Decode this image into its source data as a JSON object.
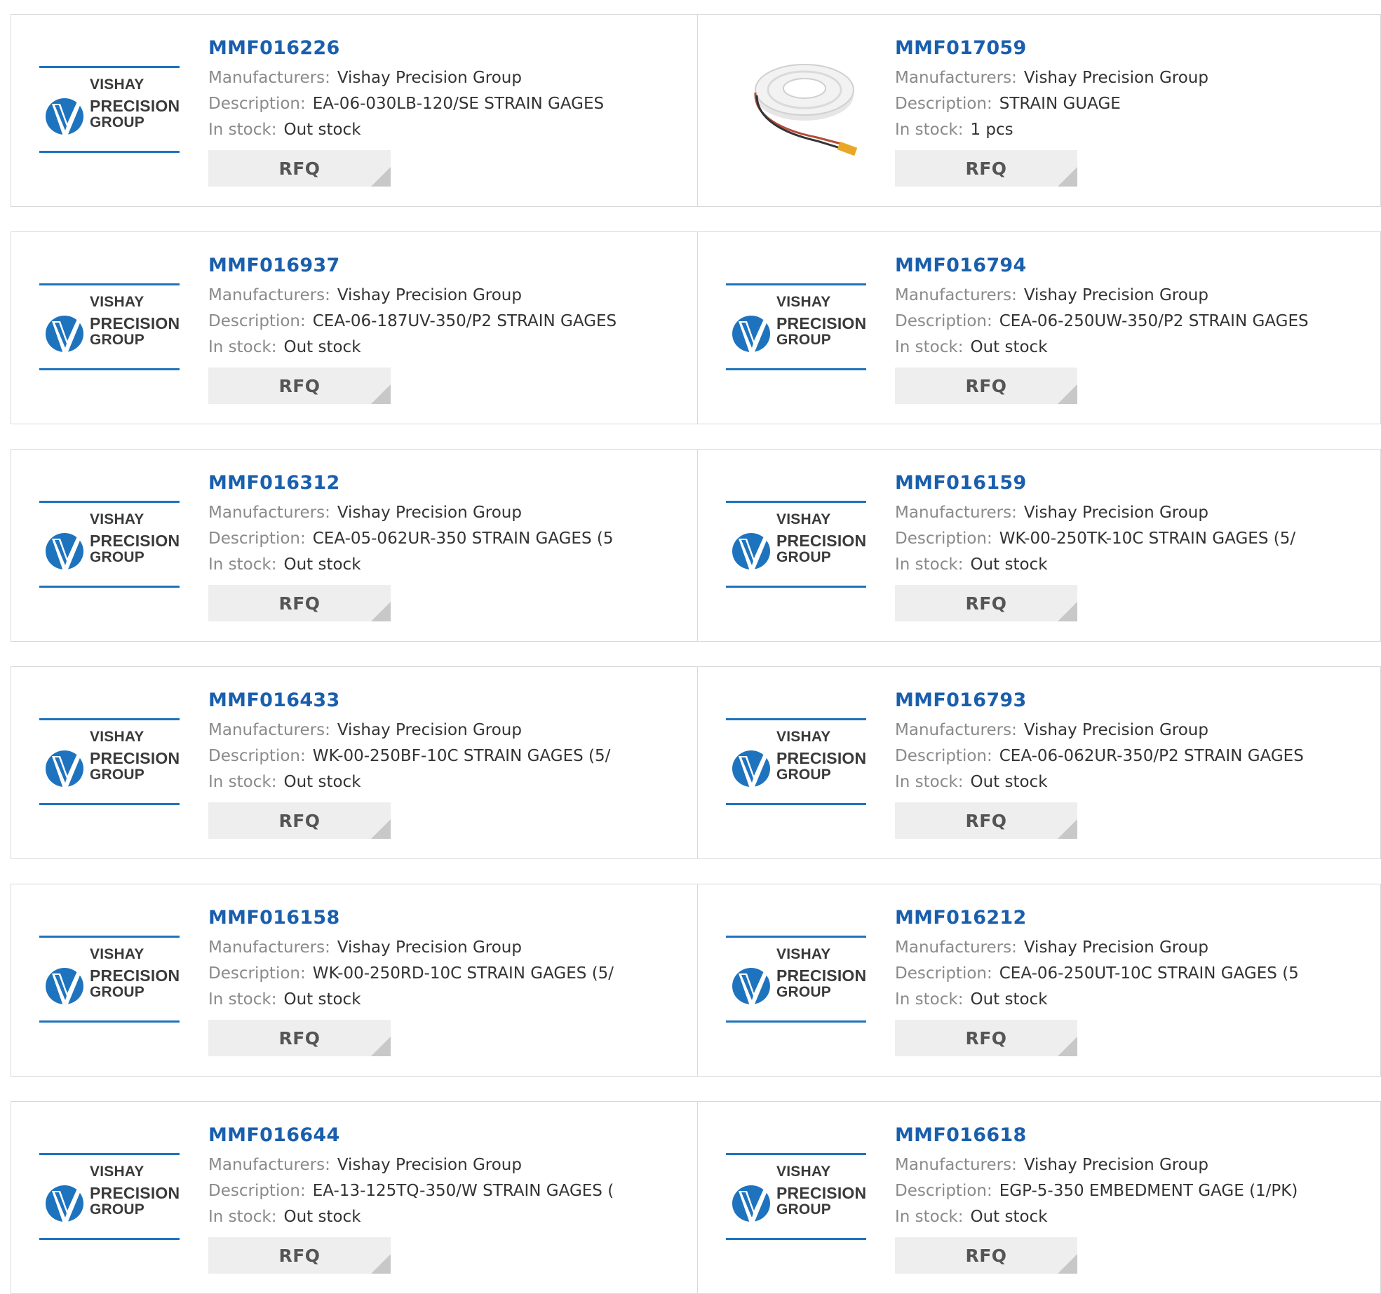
{
  "labels": {
    "manufacturers": "Manufacturers:",
    "description": "Description:",
    "in_stock": "In stock:",
    "rfq": "RFQ"
  },
  "logo": {
    "line1": "VISHAY",
    "line2": "PRECISION",
    "line3": "GROUP",
    "accent_color": "#1e73be"
  },
  "colors": {
    "part_number": "#1a5fad",
    "label": "#8a8a8a",
    "value": "#333333",
    "button_bg": "#eeeeee",
    "border": "#d9d9d9"
  },
  "products": [
    {
      "part": "MMF016226",
      "manufacturer": "Vishay Precision Group",
      "description": "EA-06-030LB-120/SE STRAIN GAGES",
      "stock": "Out stock",
      "image": "vishay-logo"
    },
    {
      "part": "MMF017059",
      "manufacturer": "Vishay Precision Group",
      "description": "STRAIN GUAGE",
      "stock": "1 pcs",
      "image": "strain-gauge-spool-photo"
    },
    {
      "part": "MMF016937",
      "manufacturer": "Vishay Precision Group",
      "description": "CEA-06-187UV-350/P2 STRAIN GAGES",
      "stock": "Out stock",
      "image": "vishay-logo"
    },
    {
      "part": "MMF016794",
      "manufacturer": "Vishay Precision Group",
      "description": "CEA-06-250UW-350/P2 STRAIN GAGES",
      "stock": "Out stock",
      "image": "vishay-logo"
    },
    {
      "part": "MMF016312",
      "manufacturer": "Vishay Precision Group",
      "description": "CEA-05-062UR-350 STRAIN GAGES (5",
      "stock": "Out stock",
      "image": "vishay-logo"
    },
    {
      "part": "MMF016159",
      "manufacturer": "Vishay Precision Group",
      "description": "WK-00-250TK-10C STRAIN GAGES (5/",
      "stock": "Out stock",
      "image": "vishay-logo"
    },
    {
      "part": "MMF016433",
      "manufacturer": "Vishay Precision Group",
      "description": "WK-00-250BF-10C STRAIN GAGES (5/",
      "stock": "Out stock",
      "image": "vishay-logo"
    },
    {
      "part": "MMF016793",
      "manufacturer": "Vishay Precision Group",
      "description": "CEA-06-062UR-350/P2 STRAIN GAGES",
      "stock": "Out stock",
      "image": "vishay-logo"
    },
    {
      "part": "MMF016158",
      "manufacturer": "Vishay Precision Group",
      "description": "WK-00-250RD-10C STRAIN GAGES (5/",
      "stock": "Out stock",
      "image": "vishay-logo"
    },
    {
      "part": "MMF016212",
      "manufacturer": "Vishay Precision Group",
      "description": "CEA-06-250UT-10C STRAIN GAGES (5",
      "stock": "Out stock",
      "image": "vishay-logo"
    },
    {
      "part": "MMF016644",
      "manufacturer": "Vishay Precision Group",
      "description": "EA-13-125TQ-350/W STRAIN GAGES (",
      "stock": "Out stock",
      "image": "vishay-logo"
    },
    {
      "part": "MMF016618",
      "manufacturer": "Vishay Precision Group",
      "description": "EGP-5-350 EMBEDMENT GAGE (1/PK)",
      "stock": "Out stock",
      "image": "vishay-logo"
    }
  ]
}
